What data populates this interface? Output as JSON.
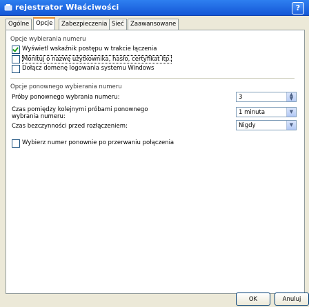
{
  "window": {
    "title": "rejestrator Właściwości",
    "help_label": "?"
  },
  "tabs": [
    "Ogólne",
    "Opcje",
    "Zabezpieczenia",
    "Sieć",
    "Zaawansowane"
  ],
  "dialing": {
    "group_title": "Opcje wybierania numeru",
    "options": [
      {
        "label": "Wyświetl wskaźnik postępu w trakcie łączenia",
        "checked": true
      },
      {
        "label": "Monituj o nazwę użytkownika, hasło, certyfikat itp.",
        "checked": false
      },
      {
        "label": "Dołącz domenę logowania systemu Windows",
        "checked": false
      }
    ]
  },
  "redial": {
    "group_title": "Opcje ponownego wybierania numeru",
    "attempts_label": "Próby ponownego wybrania numeru:",
    "attempts_value": "3",
    "interval_label": "Czas pomiędzy kolejnymi próbami ponownego wybrania numeru:",
    "interval_value": "1 minuta",
    "idle_label": "Czas bezczynności przed rozłączeniem:",
    "idle_value": "Nigdy",
    "redial_checkbox_label": "Wybierz numer ponownie po przerwaniu połączenia",
    "redial_checked": false
  },
  "buttons": {
    "ok": "OK",
    "cancel": "Anuluj"
  }
}
